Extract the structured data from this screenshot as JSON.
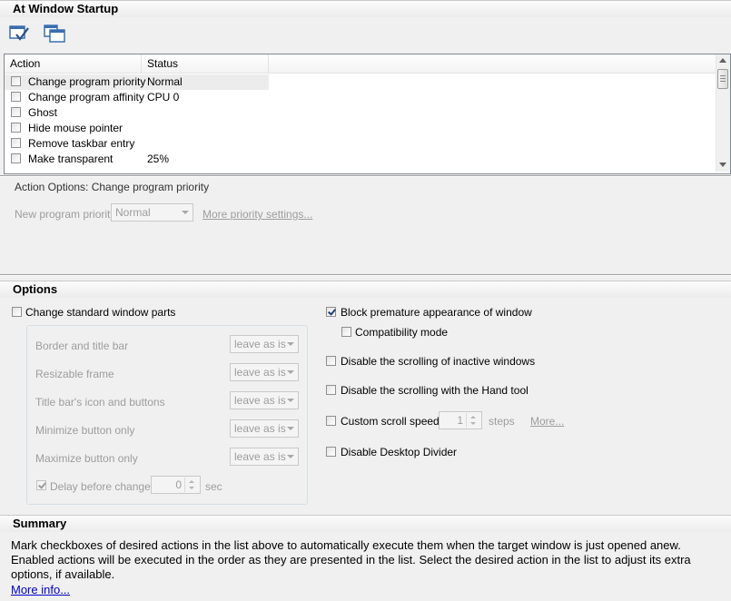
{
  "startup": {
    "title": "At Window Startup",
    "toolbar": {
      "check_all_icon": "check-all-icon",
      "windows_icon": "windows-icon"
    },
    "list": {
      "columns": [
        "Action",
        "Status"
      ],
      "rows": [
        {
          "action": "Change program priority",
          "status": "Normal",
          "checked": false,
          "selected": true
        },
        {
          "action": "Change program affinity",
          "status": "CPU 0",
          "checked": false,
          "selected": false
        },
        {
          "action": "Ghost",
          "status": "",
          "checked": false,
          "selected": false
        },
        {
          "action": "Hide mouse pointer",
          "status": "",
          "checked": false,
          "selected": false
        },
        {
          "action": "Remove taskbar entry",
          "status": "",
          "checked": false,
          "selected": false
        },
        {
          "action": "Make transparent",
          "status": "25%",
          "checked": false,
          "selected": false
        }
      ]
    }
  },
  "action_options": {
    "title": "Action Options: Change program priority",
    "priority_label": "New program priority",
    "priority_value": "Normal",
    "more_link": "More priority settings..."
  },
  "options": {
    "title": "Options",
    "change_std_parts": "Change standard window parts",
    "parts": [
      {
        "label": "Border and title bar",
        "value": "leave as is"
      },
      {
        "label": "Resizable frame",
        "value": "leave as is"
      },
      {
        "label": "Title bar's icon and buttons",
        "value": "leave as is"
      },
      {
        "label": "Minimize button only",
        "value": "leave as is"
      },
      {
        "label": "Maximize button only",
        "value": "leave as is"
      }
    ],
    "delay_label": "Delay before change",
    "delay_value": "0",
    "delay_unit": "sec",
    "block_premature": "Block premature appearance of window",
    "compat_mode": "Compatibility mode",
    "disable_inactive_scroll": "Disable the scrolling of inactive windows",
    "disable_hand_scroll": "Disable the scrolling with the Hand tool",
    "custom_scroll": "Custom scroll speed",
    "scroll_value": "1",
    "scroll_unit": "steps",
    "scroll_more": "More...",
    "desktop_divider": "Disable Desktop Divider"
  },
  "summary": {
    "title": "Summary",
    "text": "Mark checkboxes of desired actions in the list above to automatically execute them when the target window is just opened anew. Enabled actions will be executed in the order as they are presented in the list. Select the desired action in the list to adjust its extra options, if available.",
    "more_link": "More info..."
  },
  "colors": {
    "link": "#0000cc",
    "disabled_text": "#9d9d9d",
    "check": "#213d80"
  }
}
